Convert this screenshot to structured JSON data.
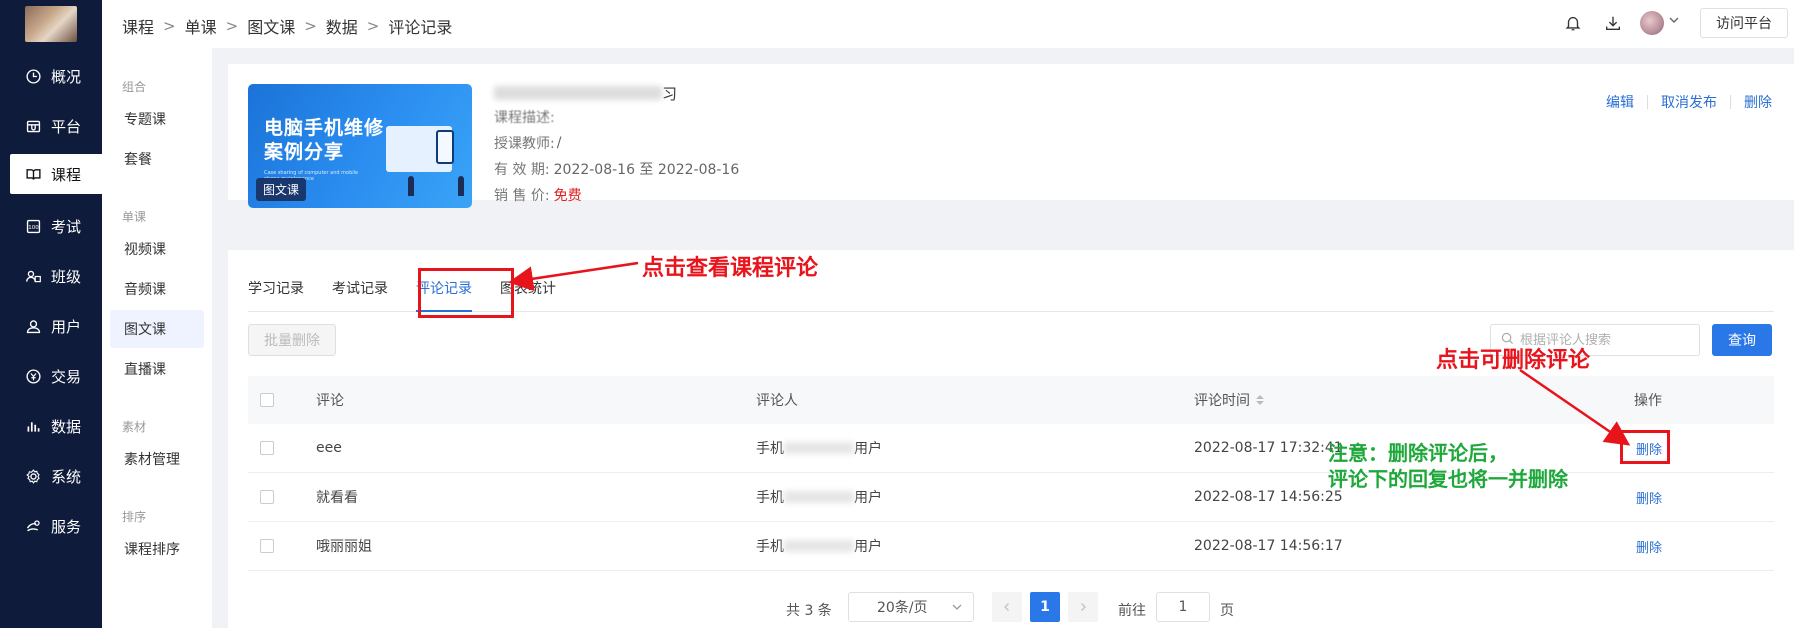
{
  "nav": {
    "items": [
      {
        "label": "概况",
        "icon": "clock-icon"
      },
      {
        "label": "平台",
        "icon": "store-icon"
      },
      {
        "label": "课程",
        "icon": "book-icon"
      },
      {
        "label": "考试",
        "icon": "exam-icon"
      },
      {
        "label": "班级",
        "icon": "class-icon"
      },
      {
        "label": "用户",
        "icon": "user-icon"
      },
      {
        "label": "交易",
        "icon": "trade-icon"
      },
      {
        "label": "数据",
        "icon": "bar-chart-icon"
      },
      {
        "label": "系统",
        "icon": "gear-icon"
      },
      {
        "label": "服务",
        "icon": "service-icon"
      }
    ],
    "active": "课程"
  },
  "subnav": {
    "groups": [
      {
        "title": "组合",
        "items": [
          "专题课",
          "套餐"
        ]
      },
      {
        "title": "单课",
        "items": [
          "视频课",
          "音频课",
          "图文课",
          "直播课"
        ]
      },
      {
        "title": "素材",
        "items": [
          "素材管理"
        ]
      },
      {
        "title": "排序",
        "items": [
          "课程排序"
        ]
      }
    ],
    "active": "图文课"
  },
  "header": {
    "breadcrumb": [
      "课程",
      "单课",
      "图文课",
      "数据",
      "评论记录"
    ],
    "visit_label": "访问平台"
  },
  "course": {
    "thumb_title_1": "电脑手机维修",
    "thumb_title_2": "案例分享",
    "thumb_sub": "Case sharing of computer and mobile phone maintenance",
    "thumb_tag": "图文课",
    "title_tail": "习",
    "desc_label": "课程描述:",
    "teacher_label": "授课教师:",
    "teacher_value": "/",
    "validity_label": "有 效 期:",
    "validity_value": "2022-08-16 至 2022-08-16",
    "price_label": "销 售 价:",
    "price_value": "免费",
    "actions": [
      "编辑",
      "取消发布",
      "删除"
    ]
  },
  "tabs": [
    "学习记录",
    "考试记录",
    "评论记录",
    "图表统计"
  ],
  "active_tab": "评论记录",
  "toolbar": {
    "bulk_delete": "批量删除",
    "search_placeholder": "根据评论人搜索",
    "query": "查询"
  },
  "table": {
    "headers": {
      "comment": "评论",
      "commenter": "评论人",
      "time": "评论时间",
      "action": "操作"
    },
    "rows": [
      {
        "comment": "eee",
        "commenter_prefix": "手机",
        "commenter_suffix": "用户",
        "time": "2022-08-17 17:32:41",
        "action": "删除"
      },
      {
        "comment": "就看看",
        "commenter_prefix": "手机",
        "commenter_suffix": "用户",
        "time": "2022-08-17 14:56:25",
        "action": "删除"
      },
      {
        "comment": "哦丽丽姐",
        "commenter_prefix": "手机",
        "commenter_suffix": "用户",
        "time": "2022-08-17 14:56:17",
        "action": "删除"
      }
    ]
  },
  "pagination": {
    "total": "共 3 条",
    "page_size": "20条/页",
    "current": "1",
    "goto_label": "前往",
    "goto_value": "1",
    "page_unit": "页"
  },
  "annotations": {
    "tab_hint": "点击查看课程评论",
    "delete_hint": "点击可删除评论",
    "note_line1": "注意：删除评论后，",
    "note_line2": "评论下的回复也将一并删除"
  },
  "colors": {
    "accent": "#2a6fd6",
    "nav_bg": "#0f1b3a",
    "annotation_red": "#e8141c",
    "annotation_green": "#1ea83a"
  }
}
